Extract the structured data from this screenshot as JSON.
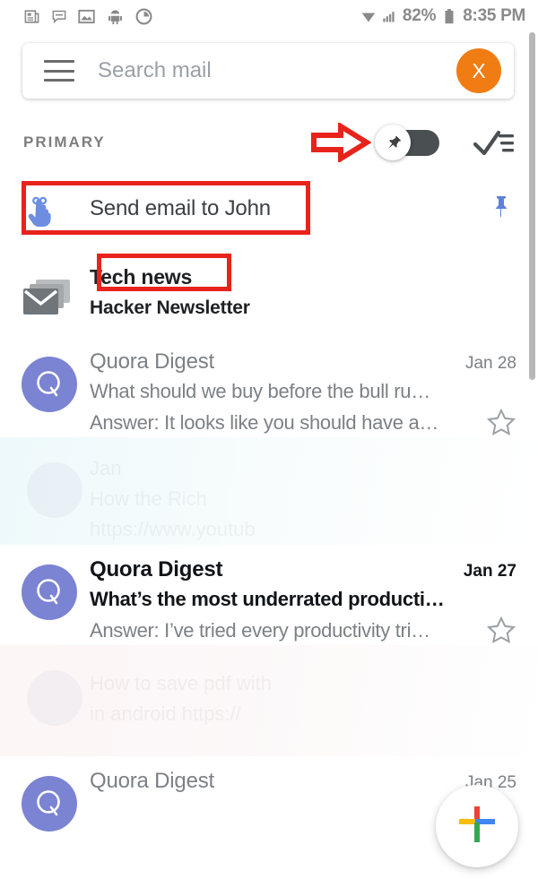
{
  "status_bar": {
    "icons": [
      "news-icon",
      "message-icon",
      "photo-icon",
      "android-icon",
      "clock-icon"
    ],
    "wifi_icon": "wifi-icon",
    "signal_icon": "signal-icon",
    "battery_percent": "82%",
    "battery_icon": "battery-icon",
    "time": "8:35 PM"
  },
  "search": {
    "menu_icon": "hamburger-menu-icon",
    "placeholder": "Search mail",
    "value": "",
    "avatar_label": "X",
    "avatar_color": "#f07c13"
  },
  "category": {
    "label": "PRIMARY",
    "annotation_arrow": "red-arrow-annotation",
    "pin_toggle": {
      "icon": "pin-icon",
      "state": "off",
      "track_color": "#4a4f52"
    },
    "select_all_icon": "checkmark-list-icon"
  },
  "reminder": {
    "icon": "pointing-hand-icon",
    "icon_color": "#6d8ee0",
    "text": "Send email to John",
    "pin_icon": "pin-icon",
    "pin_color": "#5f81d8",
    "annotation": "red-box"
  },
  "newsletter": {
    "icon": "stacked-envelope-icon",
    "title": "Tech news",
    "subtitle": "Hacker Newsletter",
    "annotation": "red-box"
  },
  "emails": [
    {
      "avatar_letter": "Q",
      "avatar_color": "#7b83d3",
      "sender": "Quora Digest",
      "date": "Jan 28",
      "subject": "What should we buy before the bull ru…",
      "snippet": "Answer: It looks like you should have a…",
      "read": true,
      "star_icon": "star-outline-icon"
    },
    {
      "avatar_letter": "Q",
      "avatar_color": "#7b83d3",
      "sender": "Quora Digest",
      "date": "Jan 27",
      "subject": "What’s the most underrated producti…",
      "snippet": "Answer: I’ve tried every productivity tri…",
      "read": false,
      "star_icon": "star-outline-icon"
    }
  ],
  "ghost_rows": [
    {
      "line1": "Jan",
      "line2": "How the Rich",
      "line3": "https://www.youtub"
    },
    {
      "line1": "",
      "line2": "How to save pdf with",
      "line3": "in android https://"
    }
  ],
  "last_email": {
    "avatar_letter": "Q",
    "avatar_color": "#7b83d3",
    "sender": "Quora Digest",
    "date": "Jan 25"
  },
  "compose_fab": {
    "icon": "google-plus-icon",
    "colors": {
      "top": "#ea4335",
      "left": "#fbbc05",
      "right": "#4285f4",
      "bottom": "#34a853"
    }
  },
  "scrollbar": {
    "name": "vertical-scrollbar"
  }
}
